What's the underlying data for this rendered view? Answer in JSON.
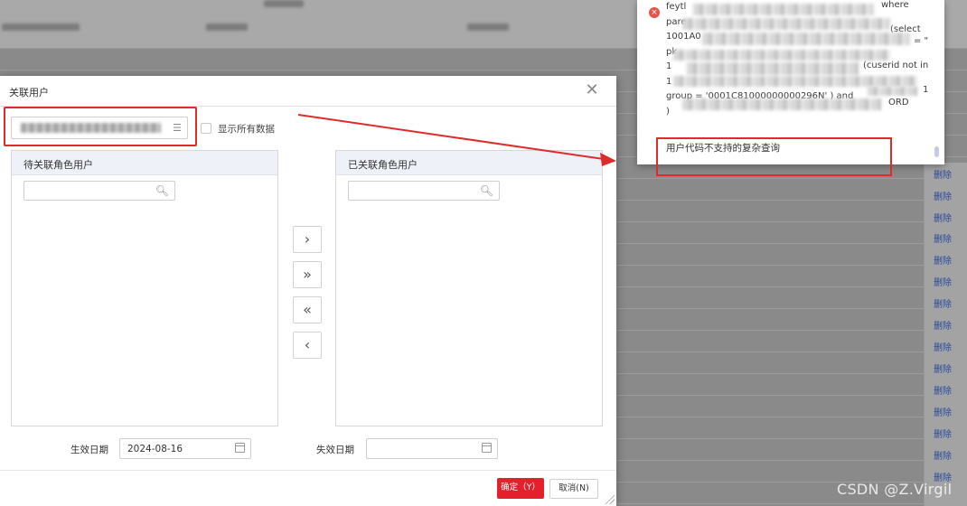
{
  "dialog": {
    "title": "关联用户",
    "close_glyph": "✕",
    "show_all_label": "显示所有数据",
    "left_panel_title": "待关联角色用户",
    "right_panel_title": "已关联角色用户",
    "move_buttons": [
      "›",
      "»",
      "«",
      "‹"
    ],
    "effective_date_label": "生效日期",
    "effective_date_value": "2024-08-16",
    "expire_date_label": "失效日期",
    "expire_date_value": "",
    "ok_label": "确定（Y）",
    "cancel_label": "取消(N)"
  },
  "error_popup": {
    "lines": [
      "feytl",
      "pare",
      "1001A0",
      "pk",
      "1",
      "1",
      "group = '0001C81000000000296N' )  and",
      ")"
    ],
    "fragments": {
      "where": "where",
      "select": "(select",
      "eq": "= \"",
      "cuserid_not_in": "(cuserid not in",
      "one": "1",
      "ord": "ORD"
    },
    "message": "用户代码不支持的复杂查询"
  },
  "background": {
    "delete_label": "删除"
  },
  "watermark": "CSDN @Z.Virgil"
}
